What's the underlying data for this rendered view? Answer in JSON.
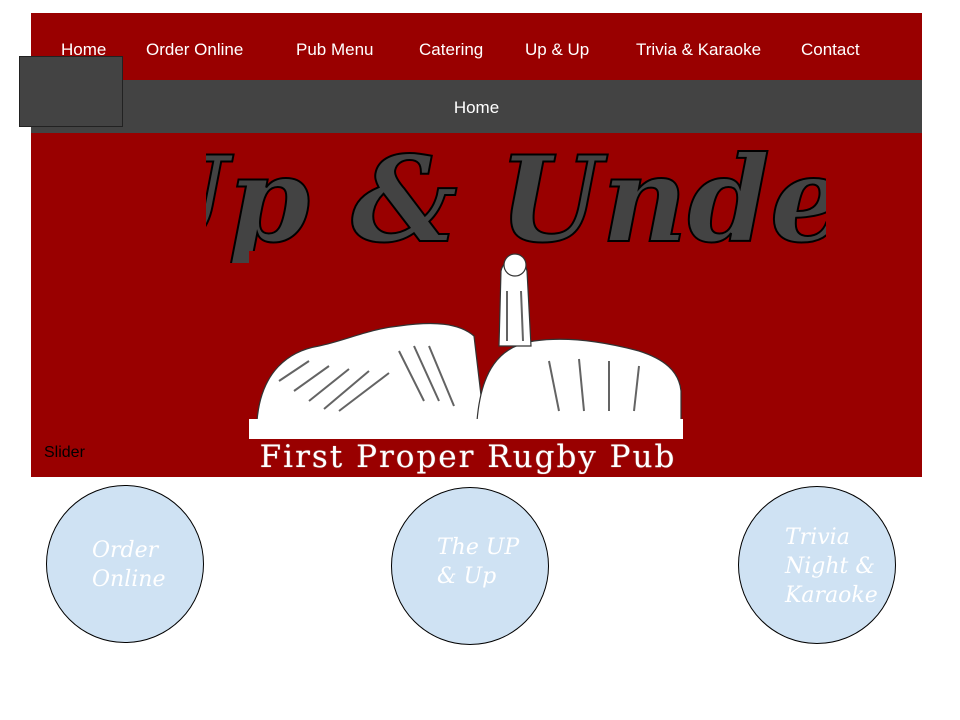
{
  "nav": {
    "items": [
      {
        "label": "Home"
      },
      {
        "label": "Order Online"
      },
      {
        "label": "Pub Menu"
      },
      {
        "label": "Catering"
      },
      {
        "label": "Up & Up"
      },
      {
        "label": "Trivia & Karaoke"
      },
      {
        "label": "Contact"
      }
    ]
  },
  "subbar": {
    "label": "Home"
  },
  "hero": {
    "title": "Up & Under",
    "tagline": "First Proper Rugby Pub",
    "slider_label": "Slider"
  },
  "features": [
    {
      "label": "Order\nOnline"
    },
    {
      "label": "The UP\n& Up"
    },
    {
      "label": "Trivia\nNight &\nKaraoke"
    }
  ],
  "colors": {
    "brand_red": "#990000",
    "bar_gray": "#434343",
    "circle_fill": "#cfe2f3"
  }
}
